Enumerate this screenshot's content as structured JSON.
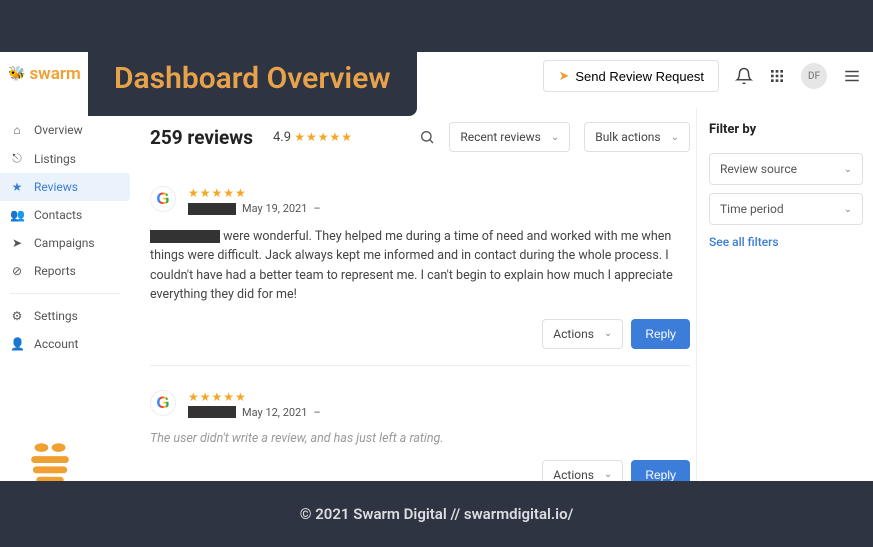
{
  "overlay_title": "Dashboard Overview",
  "logo": {
    "text": "swarm"
  },
  "header": {
    "send_request": "Send Review Request",
    "avatar_initials": "DF"
  },
  "sidebar": {
    "items": [
      {
        "icon": "⌂",
        "label": "Overview"
      },
      {
        "icon": "⎋",
        "label": "Listings"
      },
      {
        "icon": "★",
        "label": "Reviews"
      },
      {
        "icon": "👥",
        "label": "Contacts"
      },
      {
        "icon": "➤",
        "label": "Campaigns"
      },
      {
        "icon": "⊘",
        "label": "Reports"
      }
    ],
    "secondary": [
      {
        "icon": "⚙",
        "label": "Settings"
      },
      {
        "icon": "👤",
        "label": "Account"
      }
    ]
  },
  "main": {
    "count_label": "259 reviews",
    "avg_rating": "4.9",
    "stars": "★★★★★",
    "sort_label": "Recent reviews",
    "bulk_label": "Bulk actions",
    "actions_label": "Actions",
    "reply_label": "Reply",
    "reviews": [
      {
        "stars": "★★★★★",
        "date": "May 19, 2021",
        "body_suffix": " were wonderful. They helped me during a time of need and worked with me when things were difficult. Jack always kept me informed and in contact during the whole process. I couldn't have had a better team to represent me. I can't begin to explain how much I appreciate everything they did for me!"
      },
      {
        "stars": "★★★★★",
        "date": "May 12, 2021",
        "empty_text": "The user didn't write a review, and has just left a rating."
      }
    ]
  },
  "filter": {
    "title": "Filter by",
    "source": "Review source",
    "period": "Time period",
    "see_all": "See all filters"
  },
  "footer": "© 2021 Swarm Digital // swarmdigital.io/"
}
